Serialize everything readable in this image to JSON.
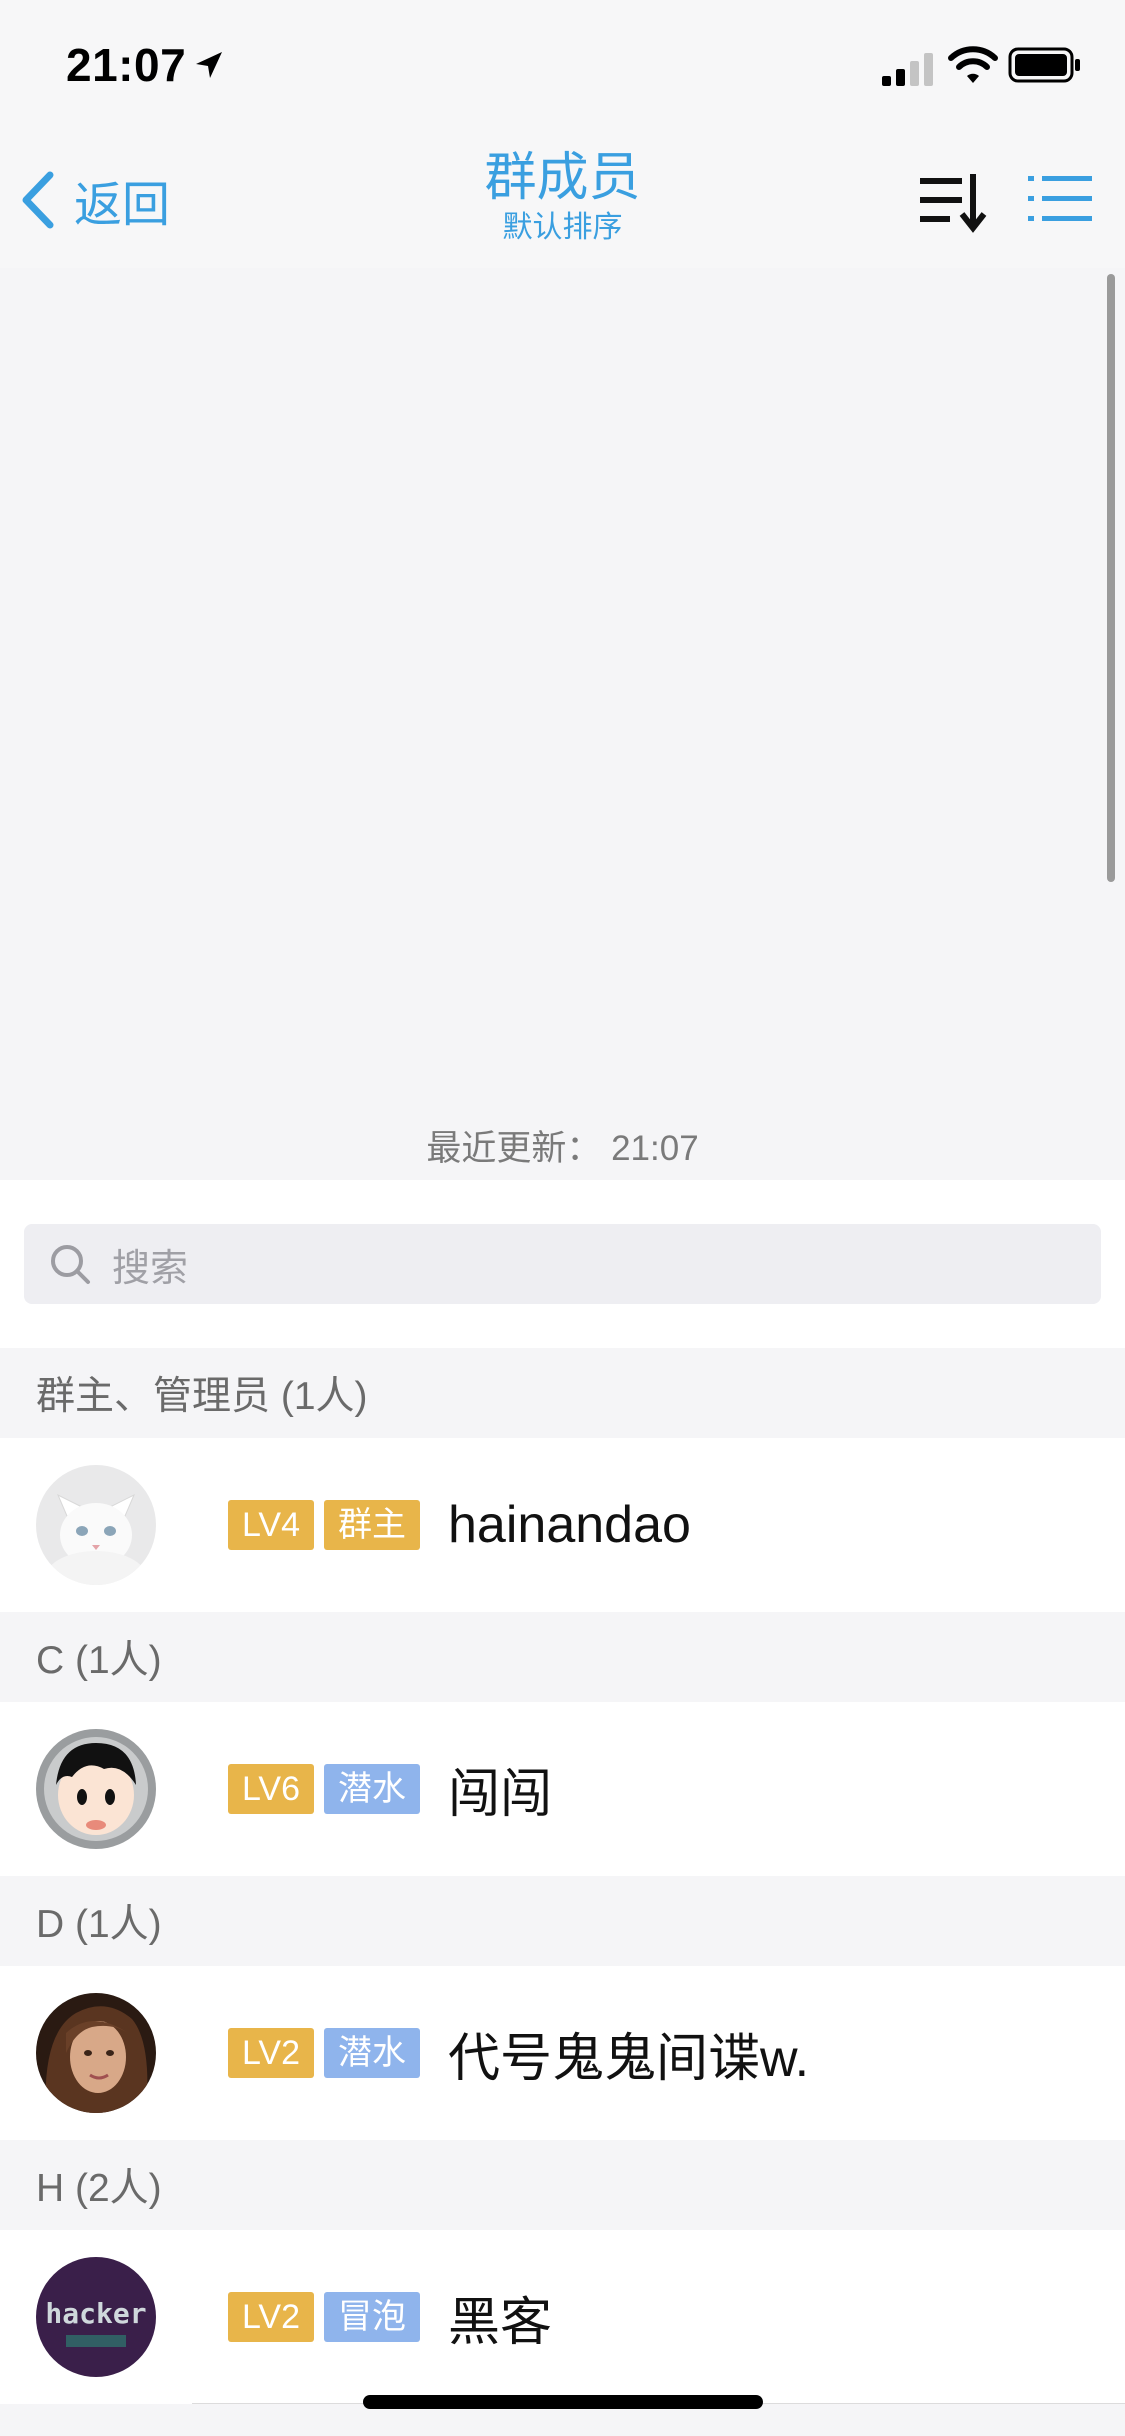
{
  "status_bar": {
    "time": "21:07"
  },
  "nav": {
    "back_label": "返回",
    "title": "群成员",
    "subtitle": "默认排序"
  },
  "refresh": {
    "last_update": "最近更新： 21:07"
  },
  "search": {
    "placeholder": "搜索"
  },
  "sections": [
    {
      "title": "群主、管理员 (1人)",
      "members": [
        {
          "level": "LV4",
          "role": "群主",
          "role_color": "#e8b54a",
          "name": "hainandao"
        }
      ]
    },
    {
      "title": "C (1人)",
      "members": [
        {
          "level": "LV6",
          "role": "潜水",
          "role_color": "#8fb4ec",
          "name": "闯闯"
        }
      ]
    },
    {
      "title": "D (1人)",
      "members": [
        {
          "level": "LV2",
          "role": "潜水",
          "role_color": "#8fb4ec",
          "name": "代号鬼鬼间谍w."
        }
      ]
    },
    {
      "title": "H (2人)",
      "members": [
        {
          "level": "LV2",
          "role": "冒泡",
          "role_color": "#8fb4ec",
          "name": "黑客",
          "avatar_text": "hacker"
        }
      ]
    }
  ],
  "colors": {
    "accent": "#3a9fe0",
    "level_badge": "#e8b54a",
    "owner_badge": "#e8b54a",
    "member_badge": "#8fb4ec"
  }
}
